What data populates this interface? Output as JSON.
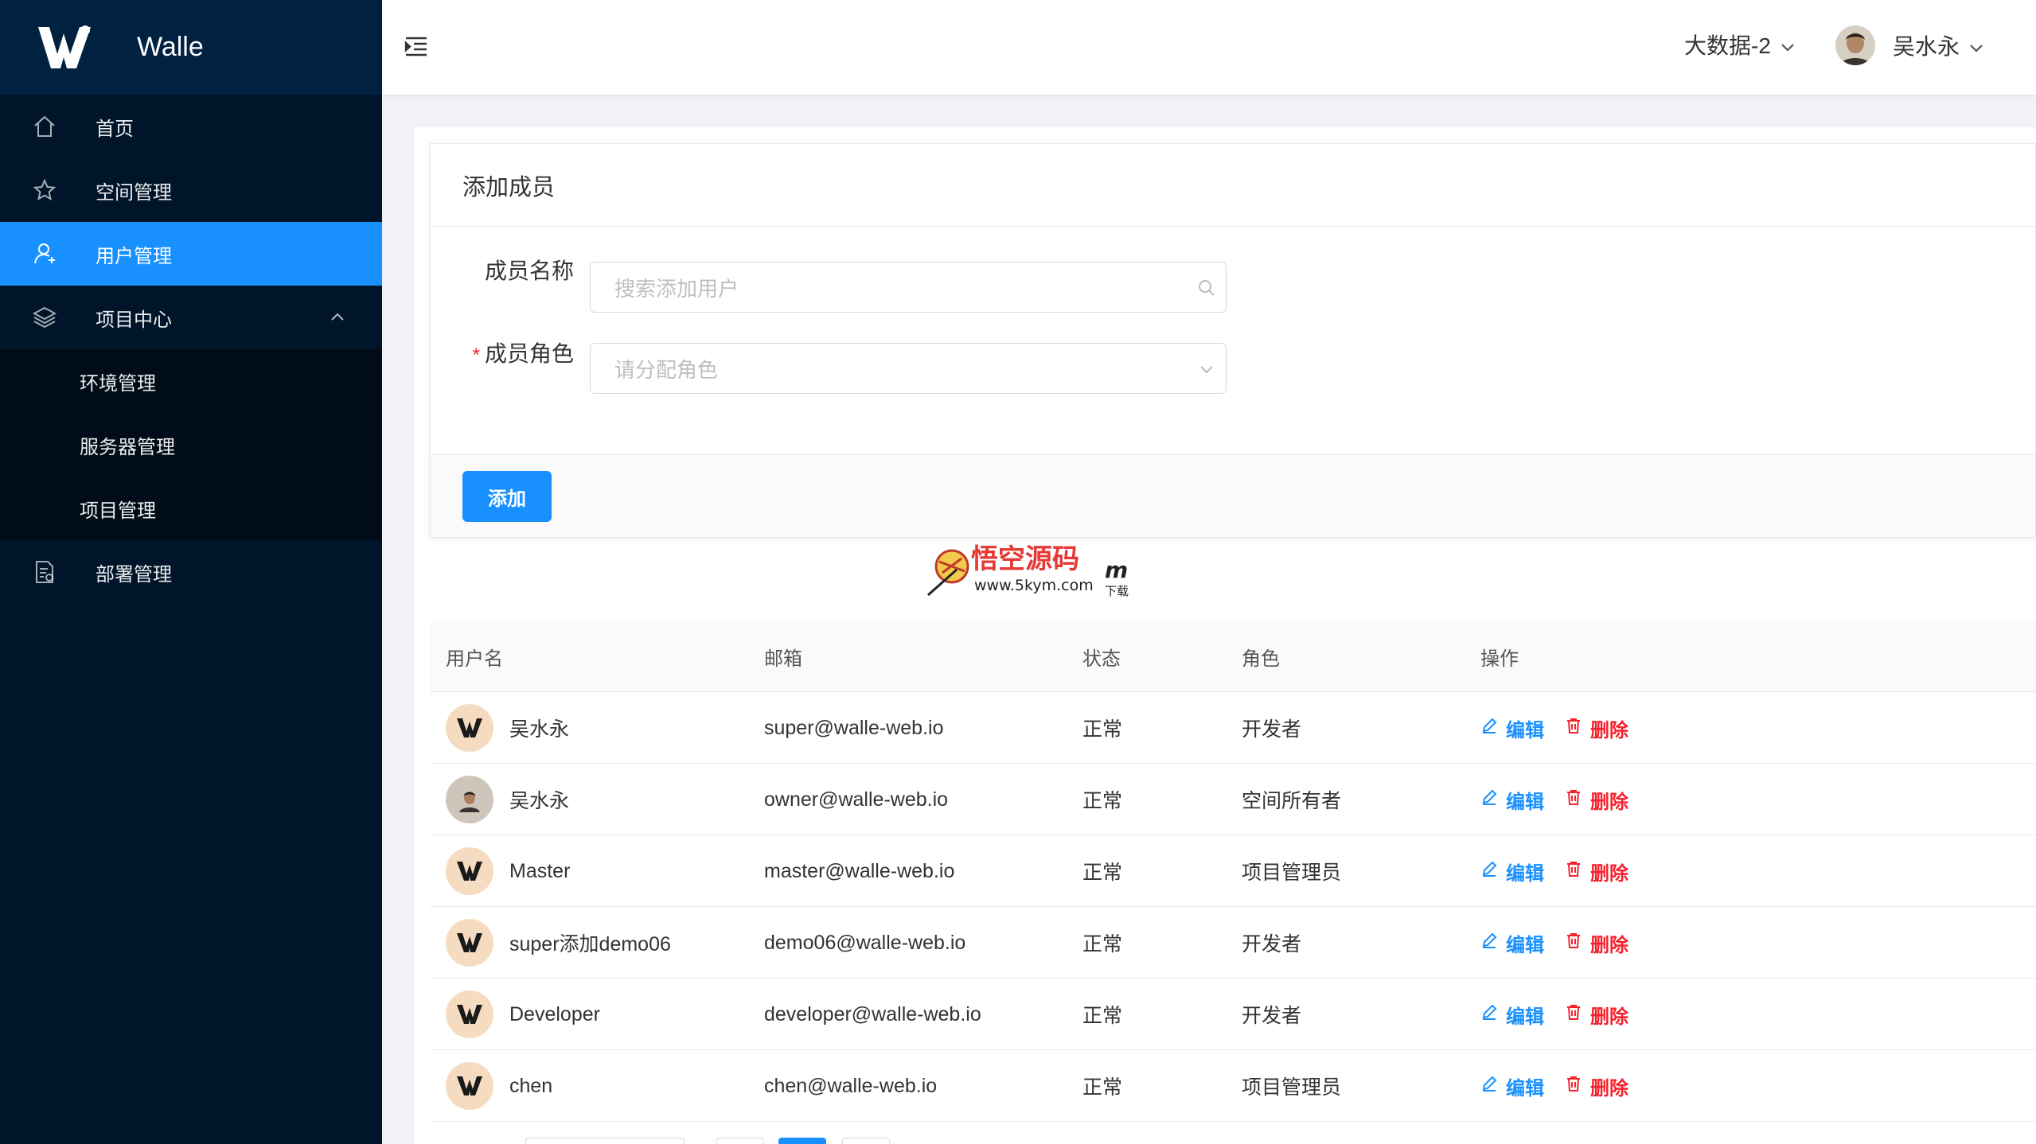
{
  "app": {
    "name": "Walle"
  },
  "sidebar": {
    "items": [
      {
        "label": "首页",
        "icon": "home-icon",
        "active": false
      },
      {
        "label": "空间管理",
        "icon": "star-icon",
        "active": false
      },
      {
        "label": "用户管理",
        "icon": "user-icon",
        "active": true
      },
      {
        "label": "项目中心",
        "icon": "layers-icon",
        "active": false,
        "expanded": true
      },
      {
        "label": "环境管理",
        "submenu": true
      },
      {
        "label": "服务器管理",
        "submenu": true
      },
      {
        "label": "项目管理",
        "submenu": true
      },
      {
        "label": "部署管理",
        "icon": "document-icon",
        "active": false
      }
    ]
  },
  "header": {
    "space_label": "大数据-2",
    "user_name": "吴水永"
  },
  "form": {
    "title": "添加成员",
    "member_name_label": "成员名称",
    "member_name_placeholder": "搜索添加用户",
    "member_role_label": "成员角色",
    "member_role_placeholder": "请分配角色",
    "required_mark": "*",
    "add_button": "添加"
  },
  "watermark": {
    "title": "悟空源码",
    "url": "www.5kym.com",
    "suffix": "m",
    "sub": "下载"
  },
  "table": {
    "headers": [
      "用户名",
      "邮箱",
      "状态",
      "角色",
      "操作"
    ],
    "edit_label": "编辑",
    "delete_label": "删除",
    "rows": [
      {
        "name": "吴水永",
        "email": "super@walle-web.io",
        "status": "正常",
        "role": "开发者",
        "avatar": "logo"
      },
      {
        "name": "吴水永",
        "email": "owner@walle-web.io",
        "status": "正常",
        "role": "空间所有者",
        "avatar": "photo"
      },
      {
        "name": "Master",
        "email": "master@walle-web.io",
        "status": "正常",
        "role": "项目管理员",
        "avatar": "logo"
      },
      {
        "name": "super添加demo06",
        "email": "demo06@walle-web.io",
        "status": "正常",
        "role": "开发者",
        "avatar": "logo"
      },
      {
        "name": "Developer",
        "email": "developer@walle-web.io",
        "status": "正常",
        "role": "开发者",
        "avatar": "logo"
      },
      {
        "name": "chen",
        "email": "chen@walle-web.io",
        "status": "正常",
        "role": "项目管理员",
        "avatar": "logo"
      }
    ]
  },
  "colors": {
    "primary": "#1890ff",
    "danger": "#f5222d",
    "sidebar": "#001529"
  }
}
